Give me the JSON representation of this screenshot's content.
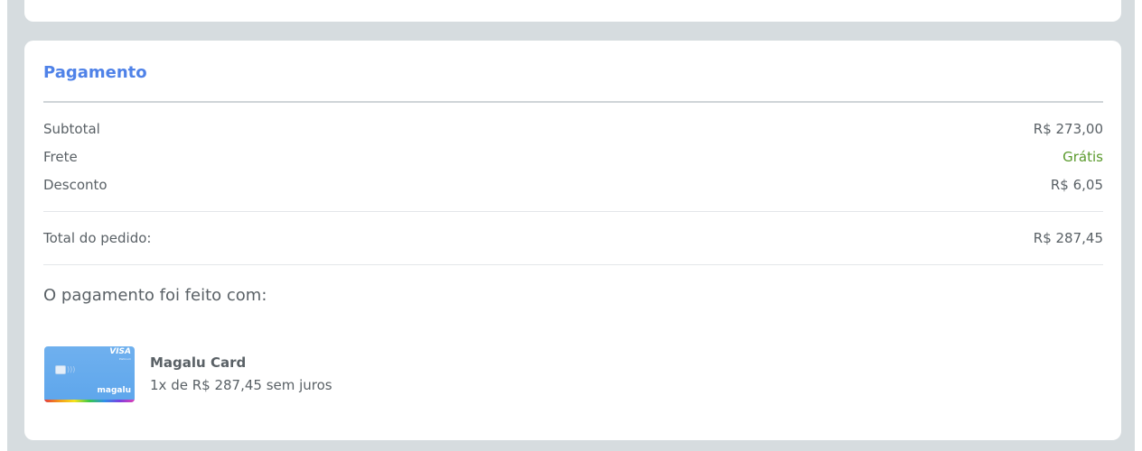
{
  "payment_section": {
    "title": "Pagamento",
    "rows": [
      {
        "label": "Subtotal",
        "value": "R$ 273,00"
      },
      {
        "label": "Frete",
        "value": "Grátis"
      },
      {
        "label": "Desconto",
        "value": "R$ 6,05"
      }
    ],
    "total": {
      "label": "Total do pedido:",
      "value": "R$ 287,45"
    },
    "paid_with_label": "O pagamento foi feito com:",
    "method": {
      "name": "Magalu Card",
      "detail": "1x de R$ 287,45 sem juros",
      "card_brand": "VISA",
      "card_brand_sub": "Platinum",
      "card_logo": "magalu"
    }
  },
  "colors": {
    "accent": "#4f82e8",
    "free_shipping": "#5a9a2c",
    "page_background": "#d6dcdf",
    "card_background": "#ffffff",
    "text": "#5a6166"
  },
  "icons": {
    "card_chip": "card-chip-icon",
    "contactless": "contactless-icon"
  }
}
